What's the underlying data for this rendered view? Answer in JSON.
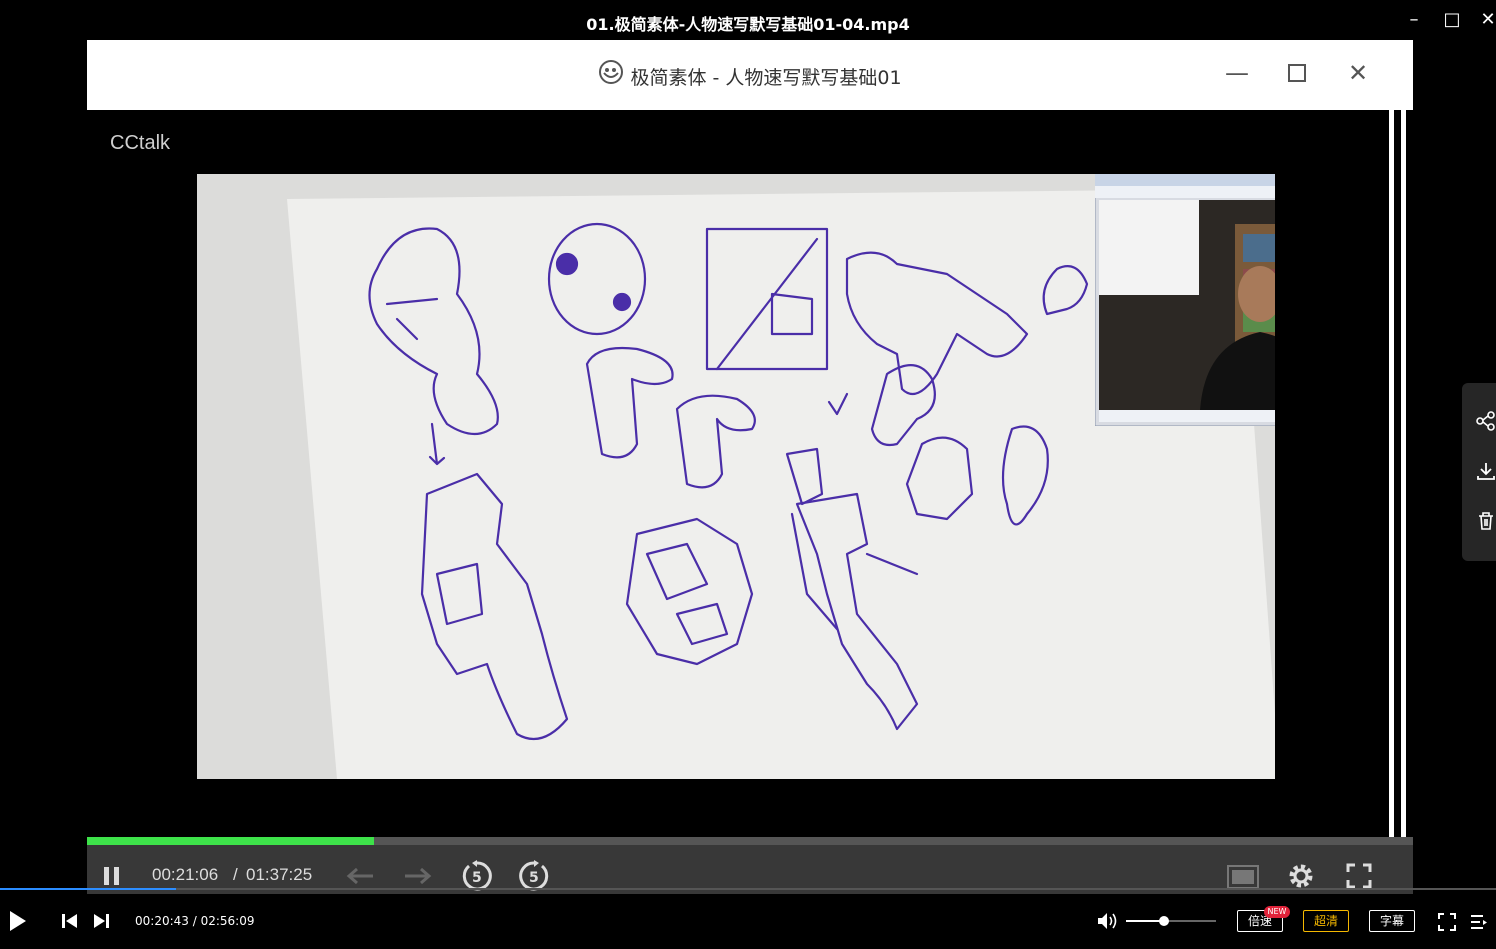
{
  "outer_window": {
    "title": "01.极简素体-人物速写默写基础01-04.mp4"
  },
  "inner_window": {
    "title": "极简素体  - 人物速写默写基础01"
  },
  "video": {
    "watermark": "CCtalk"
  },
  "inner_player": {
    "current_time": "00:21:06",
    "separator": "/",
    "duration": "01:37:25",
    "progress_fraction": 0.2165,
    "progress_color": "#3ee24a"
  },
  "outer_player": {
    "current_time": "00:20:43",
    "duration": "02:56:09",
    "time_display": "00:20:43 / 02:56:09",
    "progress_fraction": 0.1176,
    "volume_fraction": 0.42,
    "speed_label": "倍速",
    "new_badge": "NEW",
    "quality_label": "超清",
    "subtitle_label": "字幕",
    "accent_color": "#f5b800"
  },
  "side_panel": {
    "icons": [
      "share-icon",
      "download-icon",
      "delete-icon"
    ]
  }
}
